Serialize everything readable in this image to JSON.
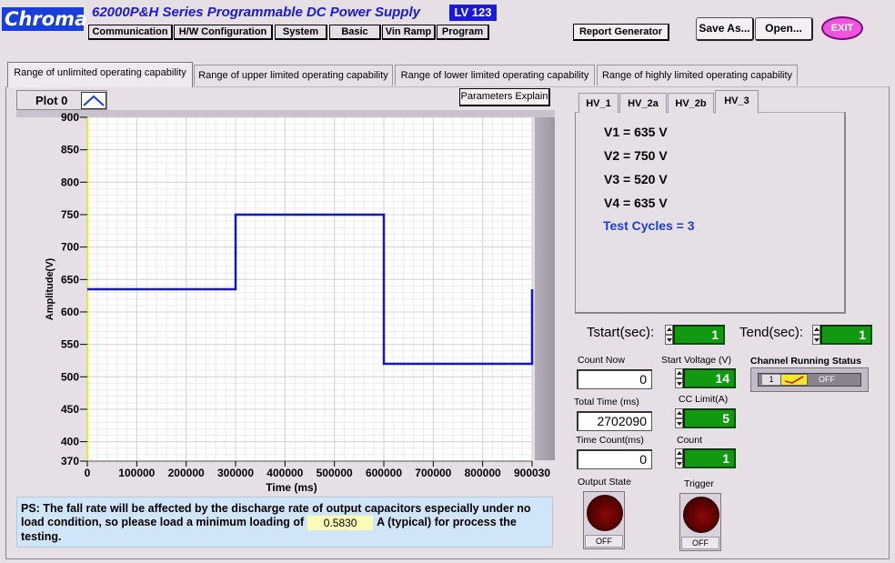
{
  "header": {
    "logo": "Chroma",
    "title": "62000P&H Series  Programmable DC Power Supply",
    "version_badge": "LV 123",
    "menu": [
      "Communication",
      "H/W Configuration",
      "System",
      "Basic",
      "Vin Ramp",
      "Program"
    ],
    "report_button": "Report Generator",
    "save_button": "Save As...",
    "open_button": "Open...",
    "exit_button": "EXIT"
  },
  "tabs": [
    "Range of unlimited operating capability",
    "Range of upper limited operating capability",
    "Range of lower limited operating capability",
    "Range of highly limited operating capability"
  ],
  "active_tab": 0,
  "plot_legend": "Plot 0",
  "params_button": "Parameters Explain",
  "chart_data": {
    "type": "line",
    "xlabel": "Time (ms)",
    "ylabel": "Amplitude(V)",
    "xlim": [
      0,
      900030
    ],
    "ylim": [
      370,
      900
    ],
    "x_ticks": [
      0,
      100000,
      200000,
      300000,
      400000,
      500000,
      600000,
      700000,
      800000,
      900030
    ],
    "y_ticks": [
      370,
      400,
      450,
      500,
      550,
      600,
      650,
      700,
      750,
      800,
      850,
      900
    ],
    "grid": true,
    "series": [
      {
        "color": "#1414c8",
        "x": [
          0,
          300000,
          300000,
          600000,
          600000,
          900000,
          900000
        ],
        "y": [
          635,
          635,
          750,
          750,
          520,
          520,
          635
        ]
      }
    ]
  },
  "note": {
    "text_before": "PS: The fall rate will be affected by the discharge rate of output capacitors especially under no load condition, so please load a minimum loading of",
    "value": "0.5830",
    "text_after": "A (typical) for process the testing."
  },
  "hv_tabs": [
    "HV_1",
    "HV_2a",
    "HV_2b",
    "HV_3"
  ],
  "hv_active": 3,
  "hv_panel": {
    "v1": "V1 = 635 V",
    "v2": "V2 = 750 V",
    "v3": "V3 = 520 V",
    "v4": "V4 = 635 V",
    "cycles": "Test Cycles = 3"
  },
  "controls": {
    "tstart_label": "Tstart(sec):",
    "tstart_value": "1",
    "tend_label": "Tend(sec):",
    "tend_value": "1",
    "count_now_label": "Count Now",
    "count_now_value": "0",
    "start_voltage_label": "Start Voltage (V)",
    "start_voltage_value": "14",
    "total_time_label": "Total Time (ms)",
    "total_time_value": "2702090",
    "cc_limit_label": "CC Limit(A)",
    "cc_limit_value": "5",
    "time_count_label": "Time Count(ms)",
    "time_count_value": "0",
    "count_label": "Count",
    "count_value": "1",
    "channel_status_label": "Channel Running Status",
    "channel_status_one": "1",
    "channel_status_off": "OFF",
    "output_state_label": "Output State",
    "output_state_value": "OFF",
    "trigger_label": "Trigger",
    "trigger_value": "OFF"
  }
}
